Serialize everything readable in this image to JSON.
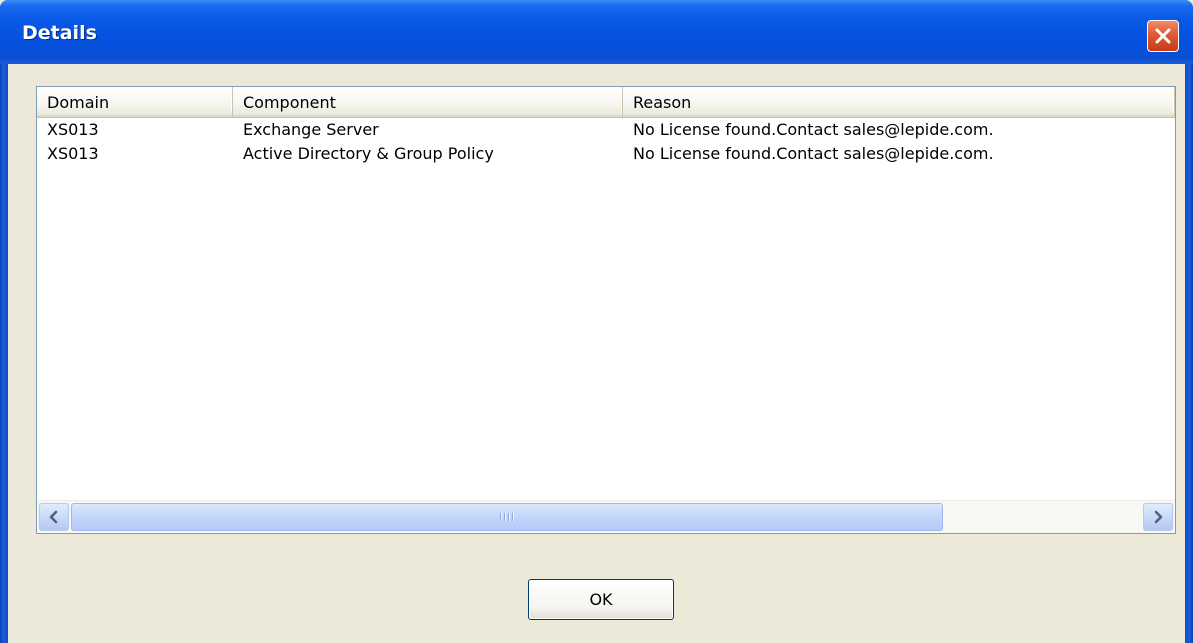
{
  "window": {
    "title": "Details"
  },
  "columns": [
    "Domain",
    "Component",
    "Reason"
  ],
  "rows": [
    {
      "domain": "XS013",
      "component": "Exchange Server",
      "reason": "No License found.Contact sales@lepide.com."
    },
    {
      "domain": "XS013",
      "component": "Active Directory & Group Policy",
      "reason": "No License found.Contact sales@lepide.com."
    }
  ],
  "buttons": {
    "ok_label": "OK"
  },
  "icons": {
    "close": "close-icon",
    "scroll_left": "chevron-left-icon",
    "scroll_right": "chevron-right-icon",
    "thumb_grip": "grip-icon"
  },
  "colors": {
    "titlebar": "#0a52de",
    "close_button": "#e05a36",
    "dialog_face": "#ece9d8"
  }
}
